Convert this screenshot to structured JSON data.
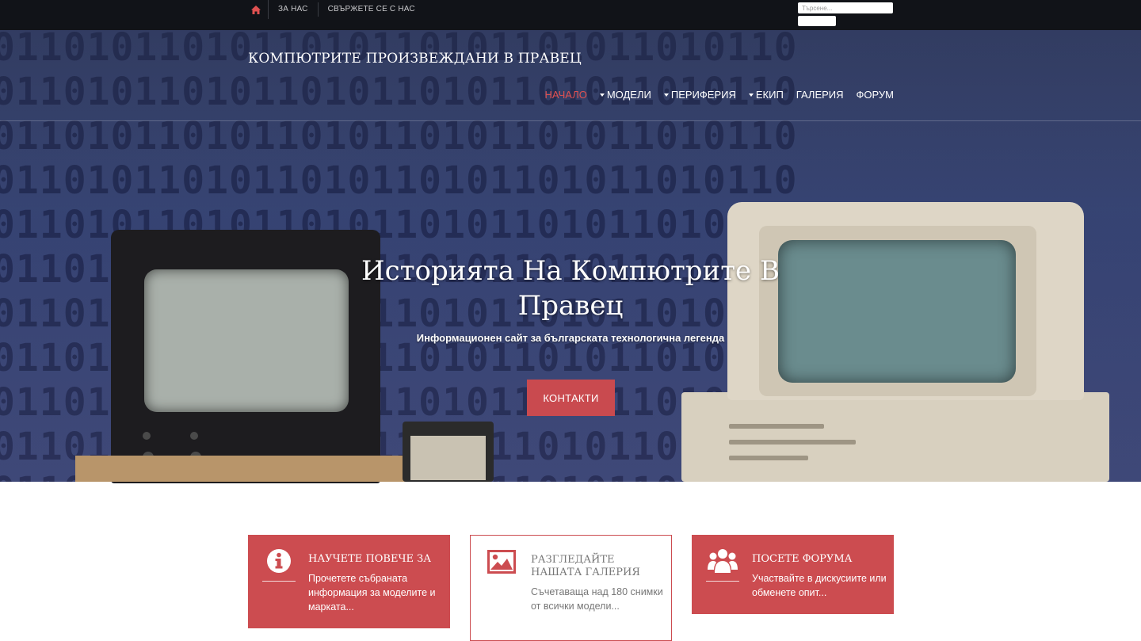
{
  "topbar": {
    "links": [
      "ЗА НАС",
      "СВЪРЖЕТЕ СЕ С НАС"
    ],
    "search_placeholder": "Търсене..."
  },
  "brand": "КОМПЮТРИТЕ ПРОИЗВЕЖДАНИ В ПРАВЕЦ",
  "nav": {
    "items": [
      {
        "label": "НАЧАЛО",
        "active": true,
        "dropdown": false
      },
      {
        "label": "МОДЕЛИ",
        "active": false,
        "dropdown": true
      },
      {
        "label": "ПЕРИФЕРИЯ",
        "active": false,
        "dropdown": true
      },
      {
        "label": "ЕКИП",
        "active": false,
        "dropdown": true
      },
      {
        "label": "ГАЛЕРИЯ",
        "active": false,
        "dropdown": false
      },
      {
        "label": "ФОРУМ",
        "active": false,
        "dropdown": false
      }
    ]
  },
  "hero": {
    "title_line1": "Историята На Компютрите В",
    "title_line2": "Правец",
    "subtitle": "Информационен сайт за българската технологична легенда",
    "button": "КОНТАКТИ",
    "binary_row": "0110101101011010110101101011010110"
  },
  "cards": [
    {
      "title": "НАУЧЕТЕ ПОВЕЧЕ ЗА",
      "text": "Прочетете събраната информация за моделите и марката...",
      "icon": "info-icon",
      "style": "red"
    },
    {
      "title": "РАЗГЛЕДАЙТЕ НАШАТА ГАЛЕРИЯ",
      "text": "Съчетаваща над 180 снимки от всички модели...",
      "icon": "image-icon",
      "style": "outline"
    },
    {
      "title": "ПОСЕТЕ ФОРУМА",
      "text": "Участвайте в дискусиите или обменете опит...",
      "icon": "users-icon",
      "style": "red"
    }
  ],
  "colors": {
    "accent": "#cc4c50",
    "active_nav": "#e05151",
    "topbar": "#111318"
  }
}
